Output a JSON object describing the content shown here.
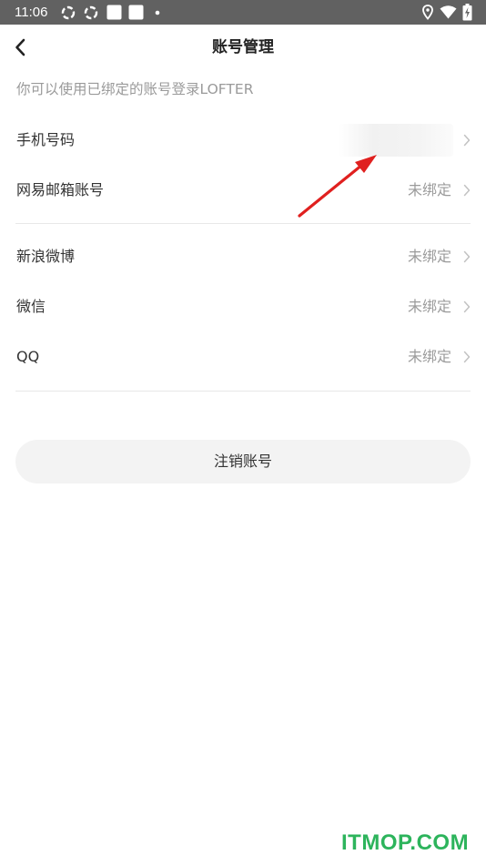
{
  "status_bar": {
    "time": "11:06",
    "icons": [
      "sync-icon",
      "sync-icon",
      "square-notification-icon",
      "square-notification-icon",
      "dot-icon",
      "location-icon",
      "wifi-icon",
      "battery-charging-icon"
    ]
  },
  "header": {
    "title": "账号管理",
    "back_icon": "chevron-left-icon"
  },
  "hint": "你可以使用已绑定的账号登录LOFTER",
  "accounts_group_1": [
    {
      "label": "手机号码",
      "value": ""
    },
    {
      "label": "网易邮箱账号",
      "value": "未绑定"
    }
  ],
  "accounts_group_2": [
    {
      "label": "新浪微博",
      "value": "未绑定"
    },
    {
      "label": "微信",
      "value": "未绑定"
    },
    {
      "label": "QQ",
      "value": "未绑定"
    }
  ],
  "deregister_label": "注销账号",
  "annotation_color": "#e0201f",
  "watermark": "ITMOP.COM",
  "colors": {
    "status_bar": "#616161",
    "title": "#222222",
    "hint": "#9a9a9a",
    "value": "#9b9b9b",
    "watermark": "#2db45c",
    "button_bg": "#f3f3f3"
  }
}
